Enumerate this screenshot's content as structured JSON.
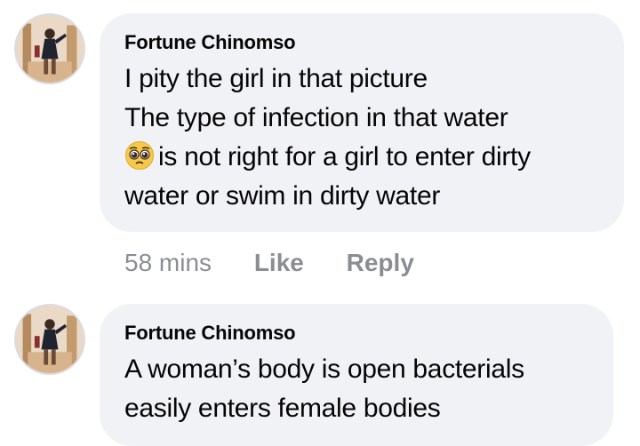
{
  "comments": [
    {
      "author": "Fortune Chinomso",
      "lines": [
        "I pity the girl in that picture",
        "The type of infection in that water",
        "is not right for a girl to enter dirty",
        "water or swim in dirty water"
      ],
      "emoji": "pleading-face-emoji",
      "time": "58 mins",
      "like_label": "Like",
      "reply_label": "Reply"
    },
    {
      "author": "Fortune Chinomso",
      "lines": [
        "A woman’s body is open bacterials",
        "easily enters female bodies"
      ]
    }
  ]
}
